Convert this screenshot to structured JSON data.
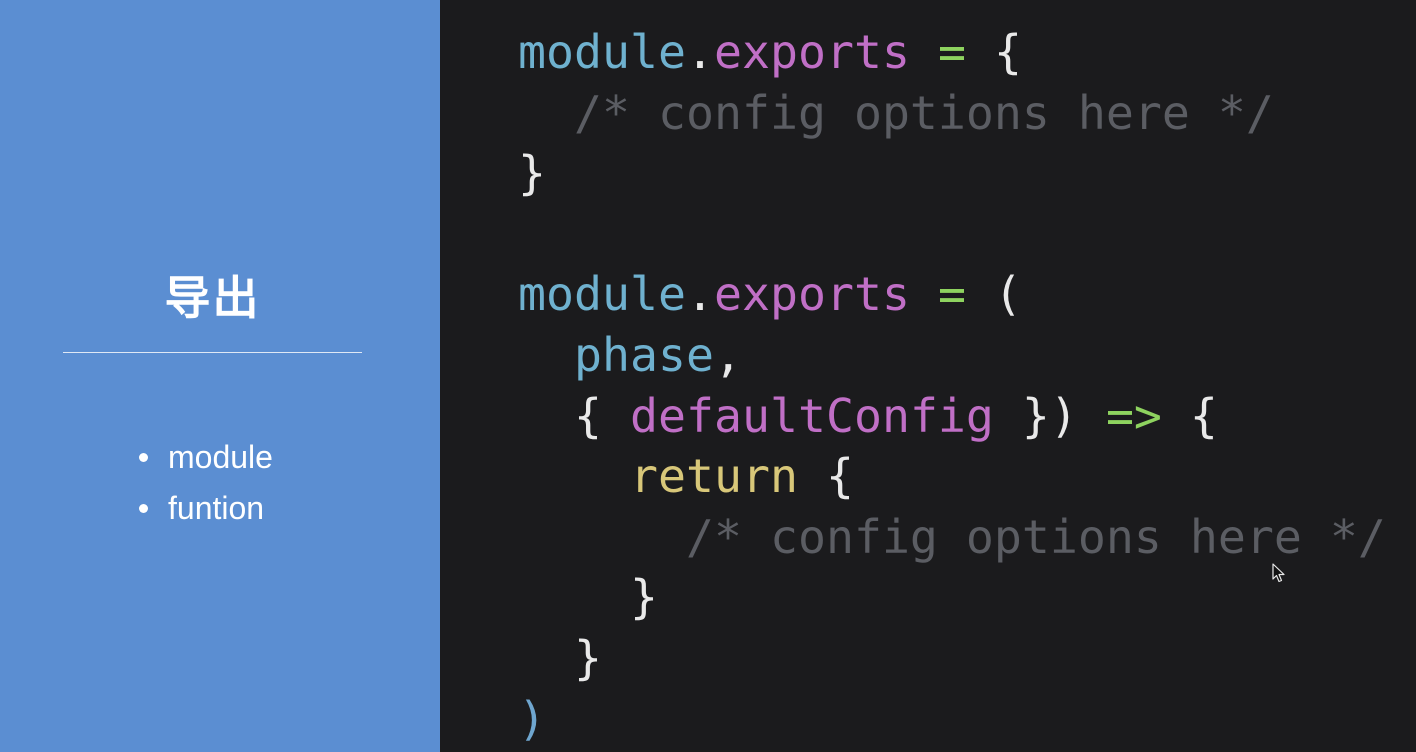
{
  "left": {
    "title": "导出",
    "bullets": [
      "module",
      "funtion"
    ]
  },
  "code": {
    "lines": [
      [
        {
          "t": "module",
          "c": "tok-module"
        },
        {
          "t": ".",
          "c": "tok-punc"
        },
        {
          "t": "exports",
          "c": "tok-prop"
        },
        {
          "t": " ",
          "c": "tok-punc"
        },
        {
          "t": "=",
          "c": "tok-op"
        },
        {
          "t": " {",
          "c": "tok-punc"
        }
      ],
      [
        {
          "t": "  /* config options here */",
          "c": "tok-comment"
        }
      ],
      [
        {
          "t": "}",
          "c": "tok-punc"
        }
      ],
      [],
      [
        {
          "t": "module",
          "c": "tok-module"
        },
        {
          "t": ".",
          "c": "tok-punc"
        },
        {
          "t": "exports",
          "c": "tok-prop"
        },
        {
          "t": " ",
          "c": "tok-punc"
        },
        {
          "t": "=",
          "c": "tok-op"
        },
        {
          "t": " (",
          "c": "tok-punc"
        }
      ],
      [
        {
          "t": "  phase",
          "c": "tok-module"
        },
        {
          "t": ",",
          "c": "tok-punc"
        }
      ],
      [
        {
          "t": "  { ",
          "c": "tok-punc"
        },
        {
          "t": "defaultConfig",
          "c": "tok-prop"
        },
        {
          "t": " })",
          "c": "tok-punc"
        },
        {
          "t": " ",
          "c": "tok-punc"
        },
        {
          "t": "=>",
          "c": "tok-op"
        },
        {
          "t": " {",
          "c": "tok-punc"
        }
      ],
      [
        {
          "t": "    ",
          "c": "tok-punc"
        },
        {
          "t": "return",
          "c": "tok-keyword"
        },
        {
          "t": " {",
          "c": "tok-punc"
        }
      ],
      [
        {
          "t": "      /* config options here */",
          "c": "tok-comment"
        }
      ],
      [
        {
          "t": "    }",
          "c": "tok-punc"
        }
      ],
      [
        {
          "t": "  }",
          "c": "tok-punc"
        }
      ],
      [
        {
          "t": ")",
          "c": "tok-paren-blue"
        }
      ]
    ]
  },
  "colors": {
    "left_panel_bg": "#5b8ed2",
    "code_bg": "#1b1b1d",
    "identifier": "#6fb1cf",
    "property": "#c06fc6",
    "operator": "#8ed35f",
    "keyword": "#d8c779",
    "comment": "#5b5d63"
  },
  "icons": {
    "cursor": "mouse-pointer-icon"
  }
}
